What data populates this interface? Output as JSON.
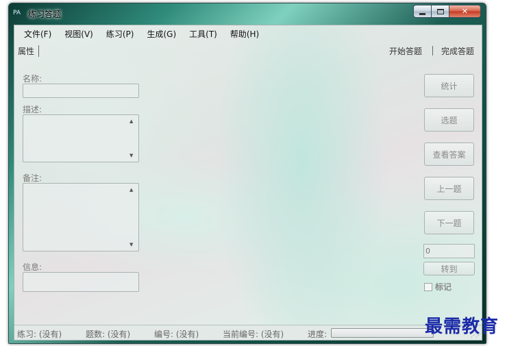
{
  "window": {
    "app_icon": "PA",
    "title": "练习答题",
    "controls": {
      "minimize": "minimize-icon",
      "maximize": "maximize-icon",
      "close": "close-icon",
      "close_glyph": "✕"
    }
  },
  "menu": [
    "文件(F)",
    "视图(V)",
    "练习(P)",
    "生成(G)",
    "工具(T)",
    "帮助(H)"
  ],
  "toolbar": {
    "properties": "属性",
    "start": "开始答题",
    "finish": "完成答题"
  },
  "form": {
    "name_label": "名称:",
    "desc_label": "描述:",
    "notes_label": "备注:",
    "info_label": "信息:",
    "scroll_up": "▲",
    "scroll_down": "▼"
  },
  "actions": {
    "stats": "统计",
    "select": "选题",
    "view_answer": "查看答案",
    "prev": "上一题",
    "next": "下一题"
  },
  "goto": {
    "value": "0",
    "button": "转到",
    "mark_label": "标记"
  },
  "status": {
    "practice": "练习: (没有)",
    "count": "题数: (没有)",
    "number": "编号: (没有)",
    "current": "当前编号: (没有)",
    "progress_label": "进度:",
    "progress_value": 0
  },
  "watermark": "最需教育"
}
